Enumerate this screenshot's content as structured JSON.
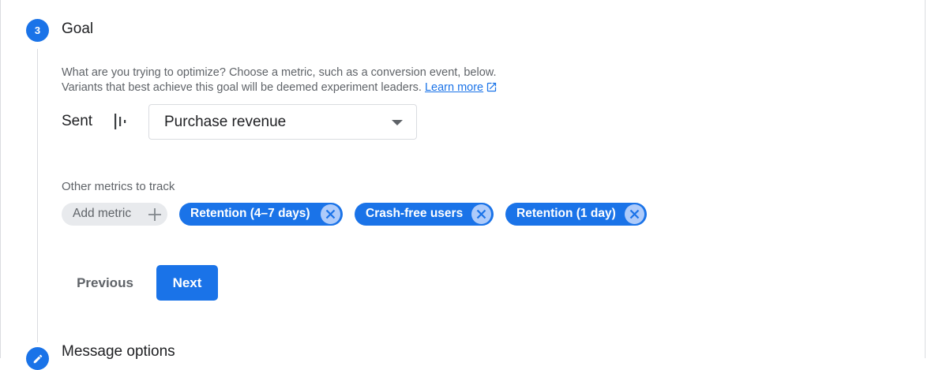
{
  "goal_step": {
    "number": "3",
    "title": "Goal",
    "description_line1": "What are you trying to optimize? Choose a metric, such as a conversion event, below.",
    "description_line2": "Variants that best achieve this goal will be deemed experiment leaders.",
    "learn_more": "Learn more",
    "sent_label": "Sent",
    "metric_select": {
      "value": "Purchase revenue"
    },
    "other_metrics_label": "Other metrics to track",
    "add_metric_label": "Add metric",
    "tracked_metrics": [
      {
        "label": "Retention (4–7 days)"
      },
      {
        "label": "Crash-free users"
      },
      {
        "label": "Retention (1 day)"
      }
    ],
    "previous_label": "Previous",
    "next_label": "Next"
  },
  "next_step": {
    "title": "Message options",
    "icon": "edit-icon"
  },
  "colors": {
    "accent": "#1a73e8",
    "chip_remove_bg": "#aecbfa",
    "muted_text": "#5f6368",
    "border": "#dadce0"
  },
  "icons": {
    "external_link": "external-link-icon",
    "event": "event-bars-icon",
    "dropdown": "caret-down-icon",
    "add": "plus-icon",
    "remove": "close-icon"
  }
}
